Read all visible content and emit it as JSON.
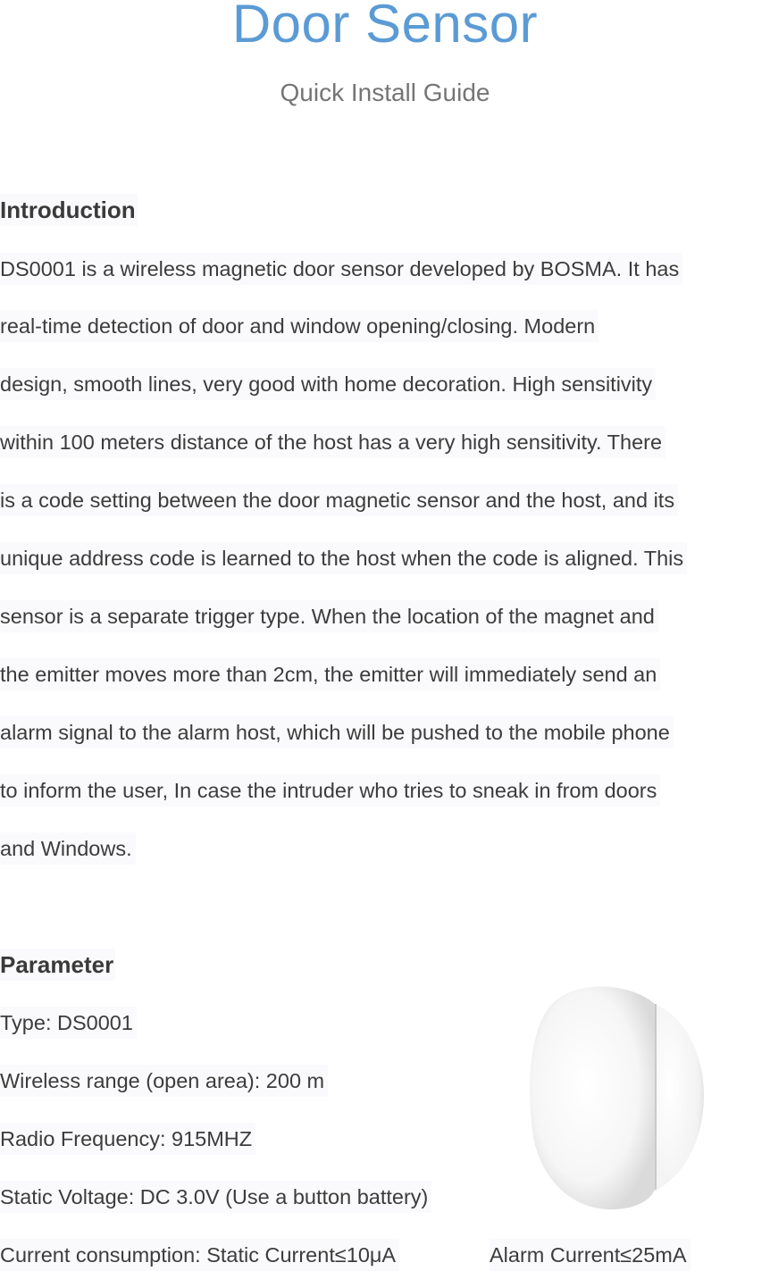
{
  "header": {
    "title": "Door Sensor",
    "subtitle": "Quick Install Guide"
  },
  "introduction": {
    "heading": "Introduction",
    "lines": [
      "DS0001 is a wireless magnetic door sensor developed by BOSMA. It has",
      "real-time detection of door and window opening/closing. Modern",
      "design, smooth lines, very good with home decoration. High sensitivity",
      "within 100 meters distance of the host has a very high sensitivity. There",
      "is a code setting between the door magnetic sensor and the host, and its",
      "unique address code is learned to the host when the code is aligned. This",
      "sensor is a separate trigger type. When the location of the magnet and",
      "the emitter moves more than 2cm, the emitter will immediately send an",
      "alarm signal to the alarm host, which will be pushed to the mobile phone",
      "to inform the user, In case the intruder who tries to sneak in from doors",
      "and Windows."
    ]
  },
  "parameter": {
    "heading": "Parameter",
    "items": [
      "Type: DS0001",
      "Wireless range (open area): 200 m",
      "Radio Frequency: 915MHZ",
      "Static Voltage: DC 3.0V (Use a button battery)"
    ],
    "current": {
      "static": "Current consumption: Static Current≤10μA",
      "alarm": "Alarm Current≤25mA"
    }
  },
  "image": {
    "icon": "door-sensor-device-image"
  },
  "colors": {
    "title": "#5b9bd5",
    "subtitle": "#757575",
    "body_text": "#3c3c3c",
    "line_highlight": "#fafafc"
  }
}
